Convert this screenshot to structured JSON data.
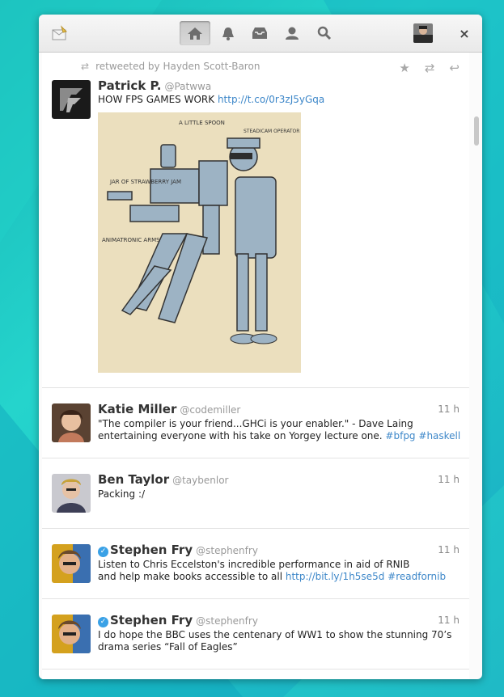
{
  "toolbar": {
    "nav": [
      {
        "name": "home",
        "active": true
      },
      {
        "name": "notifications",
        "active": false
      },
      {
        "name": "inbox",
        "active": false
      },
      {
        "name": "profile",
        "active": false
      },
      {
        "name": "search",
        "active": false
      }
    ],
    "close_label": "×"
  },
  "timeline": {
    "tweets": [
      {
        "retweeted_by": "retweeted by Hayden Scott-Baron",
        "name": "Patrick P.",
        "handle": "@Patwwa",
        "text": "HOW FPS GAMES WORK ",
        "link": "http://t.co/0r3zJ5yGqa",
        "has_media": true,
        "media_labels": {
          "jam": "JAR OF STRAWBERRY JAM",
          "spoon": "A LITTLE SPOON",
          "steadicam": "STEADICAM OPERATOR",
          "arms": "ANIMATRONIC ARMS"
        }
      },
      {
        "name": "Katie Miller",
        "handle": "@codemiller",
        "time": "11 h",
        "line1": "\"The compiler is your friend...GHCi is your enabler.\" - Dave Laing",
        "line2": "entertaining everyone with his take on Yorgey lecture one. ",
        "tags": [
          "#bfpg",
          "#haskell"
        ]
      },
      {
        "name": "Ben Taylor",
        "handle": "@taybenlor",
        "time": "11 h",
        "line1": "Packing :/"
      },
      {
        "name": "Stephen Fry",
        "handle": "@stephenfry",
        "verified": true,
        "time": "11 h",
        "line1": "Listen to Chris Eccelston's incredible performance in aid of RNIB",
        "line2": "and help make books accessible to all ",
        "link": "http://bit.ly/1h5se5d",
        "tags": [
          "#readfornib"
        ]
      },
      {
        "name": "Stephen Fry",
        "handle": "@stephenfry",
        "verified": true,
        "time": "11 h",
        "line1": "I do hope the BBC uses the centenary of WW1 to show the stunning 70’s",
        "line2": "drama series “Fall of Eagles”"
      }
    ]
  },
  "colors": {
    "link": "#3d87c9",
    "verified": "#3aa1e6",
    "background": "#1ec7c8"
  }
}
